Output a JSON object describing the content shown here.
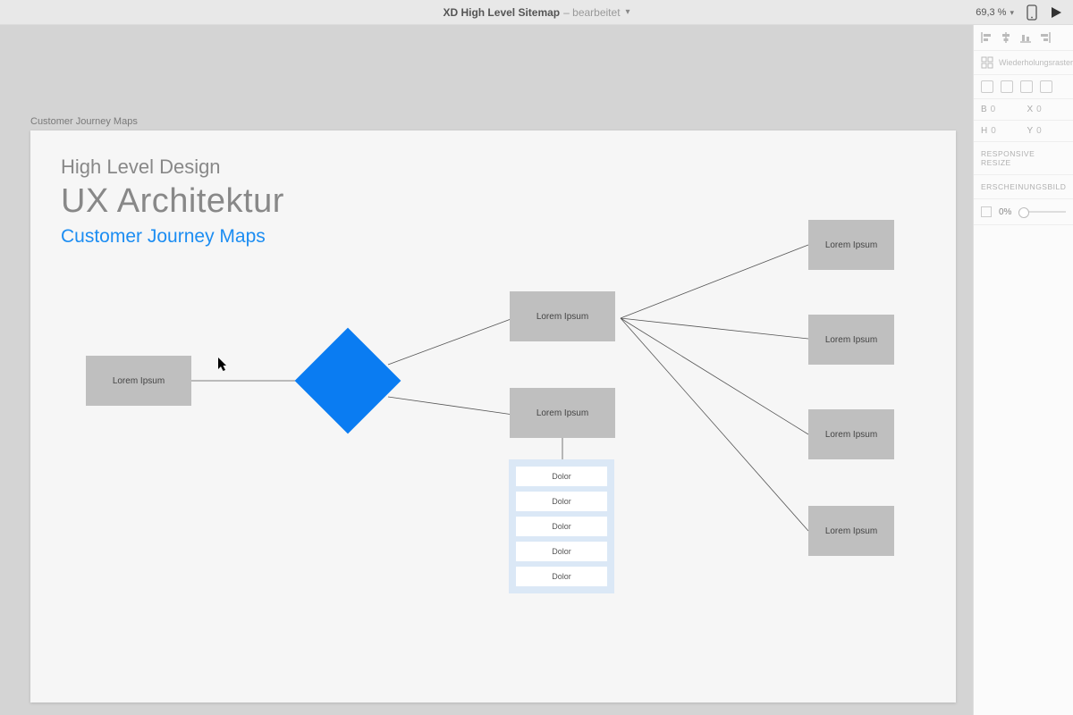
{
  "topbar": {
    "title": "XD High Level Sitemap",
    "status": "– bearbeitet",
    "zoom": "69,3 %"
  },
  "artboard": {
    "label": "Customer Journey Maps",
    "subheading": "High Level Design",
    "heading": "UX Architektur",
    "linktext": "Customer Journey Maps"
  },
  "nodes": {
    "start": "Lorem Ipsum",
    "mid_top": "Lorem Ipsum",
    "mid_bottom": "Lorem Ipsum",
    "right1": "Lorem Ipsum",
    "right2": "Lorem Ipsum",
    "right3": "Lorem Ipsum",
    "right4": "Lorem Ipsum"
  },
  "subitems": [
    "Dolor",
    "Dolor",
    "Dolor",
    "Dolor",
    "Dolor"
  ],
  "panel": {
    "repeat_grid": "Wiederholungsraster",
    "b_label": "B",
    "b_val": "0",
    "h_label": "H",
    "h_val": "0",
    "x_label": "X",
    "x_val": "0",
    "y_label": "Y",
    "y_val": "0",
    "section1": "RESPONSIVE RESIZE",
    "section2": "ERSCHEINUNGSBILD",
    "opacity": "0%"
  }
}
